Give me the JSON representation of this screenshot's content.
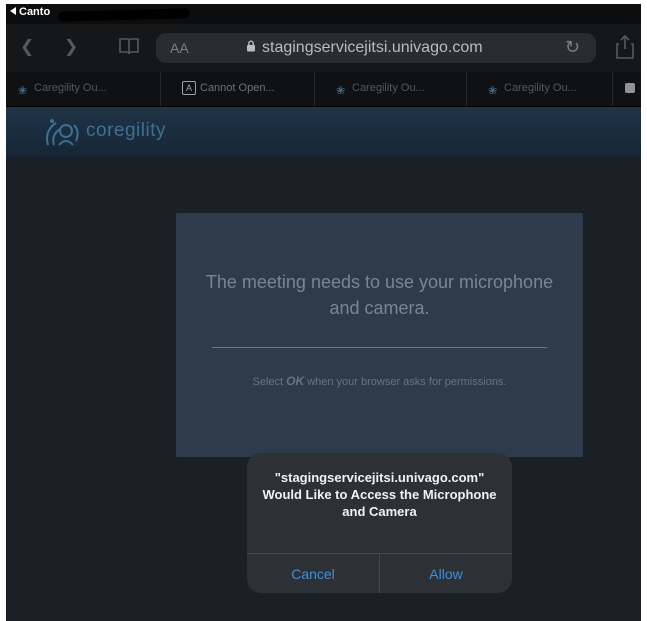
{
  "status_bar": {
    "back_app": "Canto"
  },
  "toolbar": {
    "reader_label": "AA",
    "url": "stagingservicejitsi.univago.com"
  },
  "tabs": [
    {
      "label": "Caregility Ou..."
    },
    {
      "label": "Cannot Open..."
    },
    {
      "label": "Caregility Ou..."
    },
    {
      "label": "Caregility Ou..."
    }
  ],
  "site": {
    "logo_text": "coregility"
  },
  "card": {
    "title": "The meeting needs to use your microphone and camera.",
    "sub_before": "Select ",
    "sub_ok": "OK",
    "sub_after": " when your browser asks for permissions."
  },
  "alert": {
    "message": "\"stagingservicejitsi.univago.com\" Would Like to Access the Microphone and Camera",
    "cancel_label": "Cancel",
    "allow_label": "Allow"
  },
  "colors": {
    "accent_blue": "#3e8fdc",
    "card_bg": "#2e3b4a",
    "page_bg": "#1b2026"
  }
}
